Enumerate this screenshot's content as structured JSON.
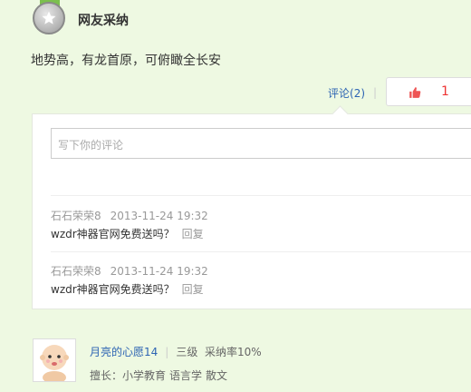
{
  "header": {
    "title": "网友采纳"
  },
  "answer": {
    "text": "地势高，有龙首原，可俯瞰全长安"
  },
  "actions": {
    "comment_label": "评论",
    "comment_count": "(2)",
    "separator": "|",
    "like_count": "1"
  },
  "comment_input": {
    "placeholder": "写下你的评论"
  },
  "comments": [
    {
      "user": "石石荣荣8",
      "time": "2013-11-24 19:32",
      "text": "wzdr神器官网免费送吗？",
      "reply": "回复"
    },
    {
      "user": "石石荣荣8",
      "time": "2013-11-24 19:32",
      "text": "wzdr神器官网免费送吗？",
      "reply": "回复"
    }
  ],
  "answerer": {
    "name": "月亮的心愿14",
    "separator": "|",
    "level": "三级",
    "adopt_rate": "采纳率10%",
    "expertise_label": "擅长：",
    "tags": [
      "小学教育",
      "语言学",
      "散文"
    ]
  },
  "icons": {
    "medal": "star-medal-icon",
    "like": "thumbs-up-icon",
    "avatar": "cartoon-baby-avatar"
  },
  "colors": {
    "page_bg": "#eef9e2",
    "link": "#2d64b3",
    "like_count": "#e33333"
  }
}
